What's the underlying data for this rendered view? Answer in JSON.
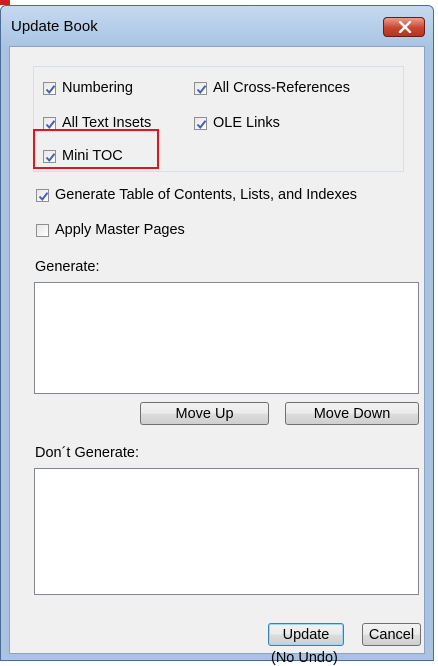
{
  "window": {
    "title": "Update Book",
    "close_icon": "close-x-icon"
  },
  "options": {
    "numbering": {
      "label": "Numbering",
      "checked": true
    },
    "all_cross_references": {
      "label": "All Cross-References",
      "checked": true
    },
    "all_text_insets": {
      "label": "All Text Insets",
      "checked": true
    },
    "ole_links": {
      "label": "OLE Links",
      "checked": true
    },
    "mini_toc": {
      "label": "Mini TOC",
      "checked": true
    }
  },
  "generate_toc": {
    "label": "Generate Table of Contents, Lists, and Indexes",
    "checked": true
  },
  "apply_master_pages": {
    "label": "Apply Master Pages",
    "checked": false
  },
  "generate_list": {
    "label": "Generate:",
    "items": []
  },
  "dont_generate_list": {
    "label": "Don´t Generate:",
    "items": []
  },
  "buttons": {
    "move_up": "Move Up",
    "move_down": "Move Down",
    "update": "Update",
    "cancel": "Cancel"
  },
  "undo_note": "(No Undo)",
  "colors": {
    "highlight": "#e0161b",
    "titlebar": "#b7cfe9",
    "close_button": "#c7452e",
    "check": "#4a5fb6"
  }
}
